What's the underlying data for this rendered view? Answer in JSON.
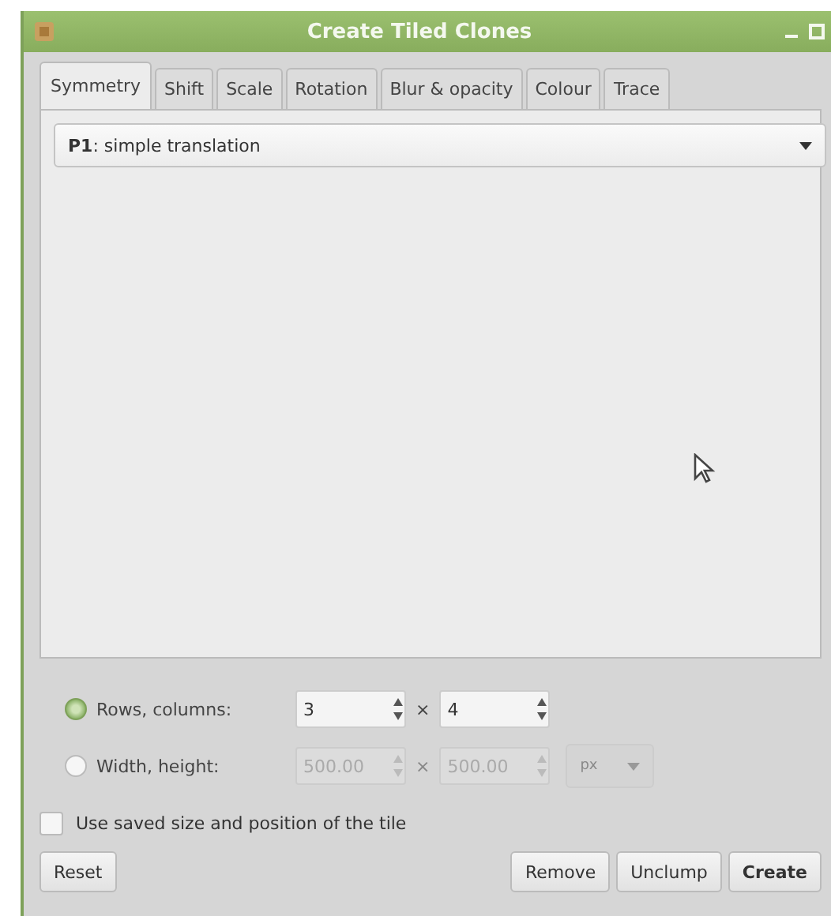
{
  "window": {
    "title": "Create Tiled Clones"
  },
  "tabs": [
    {
      "label": "Symmetry",
      "selected": true
    },
    {
      "label": "Shift",
      "selected": false
    },
    {
      "label": "Scale",
      "selected": false
    },
    {
      "label": "Rotation",
      "selected": false
    },
    {
      "label": "Blur & opacity",
      "selected": false
    },
    {
      "label": "Colour",
      "selected": false
    },
    {
      "label": "Trace",
      "selected": false
    }
  ],
  "symmetry_select": {
    "value": "**P1**: simple translation"
  },
  "size_options": [
    {
      "label": "Rows, columns:",
      "selected": true,
      "first": "3",
      "second": "4",
      "separator": "×",
      "disabled": false
    },
    {
      "label": "Width, height:",
      "selected": false,
      "first": "500.00",
      "second": "500.00",
      "separator": "×",
      "disabled": true,
      "unit": "px"
    }
  ],
  "use_saved": {
    "label": "Use saved size and position of the tile",
    "checked": false
  },
  "buttons": [
    {
      "label": "Reset",
      "kind": "left"
    },
    {
      "label": "Remove",
      "kind": "right"
    },
    {
      "label": "Unclump",
      "kind": "right"
    },
    {
      "label": "Create",
      "kind": "default"
    }
  ]
}
